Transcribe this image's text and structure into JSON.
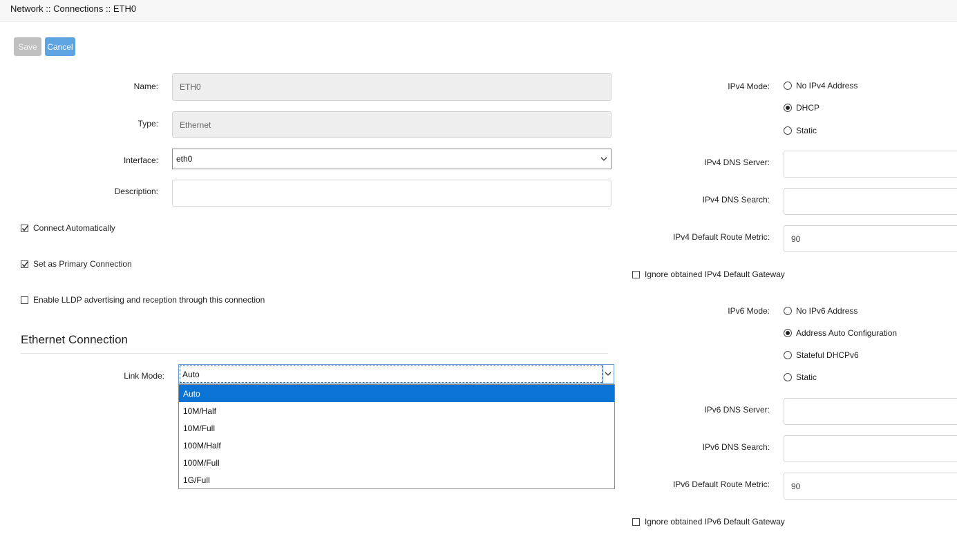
{
  "breadcrumb": "Network :: Connections :: ETH0",
  "toolbar": {
    "save_label": "Save",
    "cancel_label": "Cancel"
  },
  "form": {
    "name_label": "Name:",
    "name_value": "ETH0",
    "type_label": "Type:",
    "type_value": "Ethernet",
    "interface_label": "Interface:",
    "interface_value": "eth0",
    "description_label": "Description:",
    "description_value": "",
    "connect_auto_label": "Connect Automatically",
    "connect_auto_checked": true,
    "primary_label": "Set as Primary Connection",
    "primary_checked": true,
    "lldp_label": "Enable LLDP advertising and reception through this connection",
    "lldp_checked": false
  },
  "ethernet": {
    "section_title": "Ethernet Connection",
    "link_mode_label": "Link Mode:",
    "link_mode_value": "Auto",
    "options": [
      "Auto",
      "10M/Half",
      "10M/Full",
      "100M/Half",
      "100M/Full",
      "1G/Full"
    ],
    "selected_index": 0
  },
  "ipv4": {
    "mode_label": "IPv4 Mode:",
    "modes": [
      "No IPv4 Address",
      "DHCP",
      "Static"
    ],
    "selected_mode": "DHCP",
    "dns_server_label": "IPv4 DNS Server:",
    "dns_server_value": "",
    "dns_search_label": "IPv4 DNS Search:",
    "dns_search_value": "",
    "metric_label": "IPv4 Default Route Metric:",
    "metric_value": "90",
    "ignore_gw_label": "Ignore obtained IPv4 Default Gateway",
    "ignore_gw_checked": false
  },
  "ipv6": {
    "mode_label": "IPv6 Mode:",
    "modes": [
      "No IPv6 Address",
      "Address Auto Configuration",
      "Stateful DHCPv6",
      "Static"
    ],
    "selected_mode": "Address Auto Configuration",
    "dns_server_label": "IPv6 DNS Server:",
    "dns_server_value": "",
    "dns_search_label": "IPv6 DNS Search:",
    "dns_search_value": "",
    "metric_label": "IPv6 Default Route Metric:",
    "metric_value": "90",
    "ignore_gw_label": "Ignore obtained IPv6 Default Gateway",
    "ignore_gw_checked": false
  }
}
